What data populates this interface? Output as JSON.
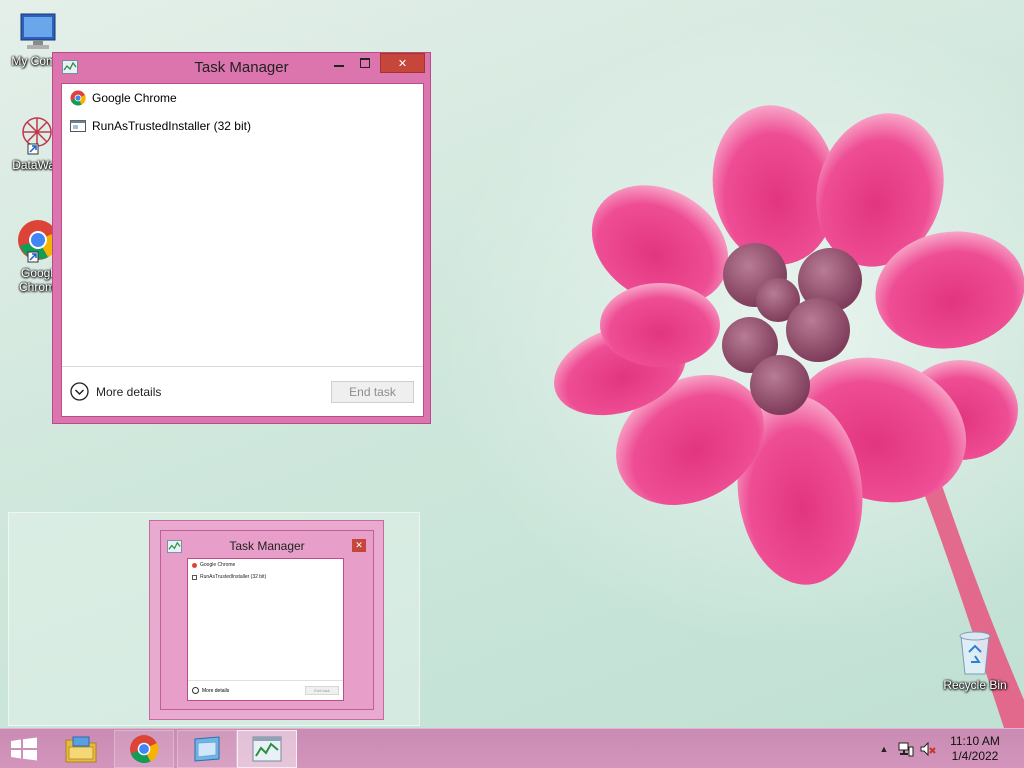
{
  "desktop": {
    "icons": [
      {
        "id": "my-computer",
        "label": "My Comp"
      },
      {
        "id": "datawag",
        "label": "DataWag"
      },
      {
        "id": "google-chrome",
        "label": "Googl",
        "label2": "Chrom"
      },
      {
        "id": "recycle-bin",
        "label": "Recycle Bin"
      }
    ]
  },
  "task_manager": {
    "title": "Task Manager",
    "close_glyph": "✕",
    "processes": [
      {
        "name": "Google Chrome",
        "icon": "chrome-icon"
      },
      {
        "name": "RunAsTrustedInstaller (32 bit)",
        "icon": "app-window-icon"
      }
    ],
    "more_details": "More details",
    "end_task": "End task"
  },
  "preview": {
    "title": "Task Manager",
    "close_glyph": "✕",
    "processes": [
      "Google Chrome",
      "RunAsTrustedInstaller (32 bit)"
    ],
    "more_details": "More details",
    "end_task": "End task"
  },
  "taskbar": {
    "buttons": [
      "start-icon",
      "file-explorer-icon",
      "chrome-icon",
      "app-icon",
      "task-manager-icon"
    ],
    "tray": {
      "chevron": "▲"
    },
    "clock": {
      "time": "11:10 AM",
      "date": "1/4/2022"
    }
  },
  "colors": {
    "window_frame": "#dc74ad",
    "close_button": "#c7463b",
    "taskbar": "#cf90b8"
  }
}
